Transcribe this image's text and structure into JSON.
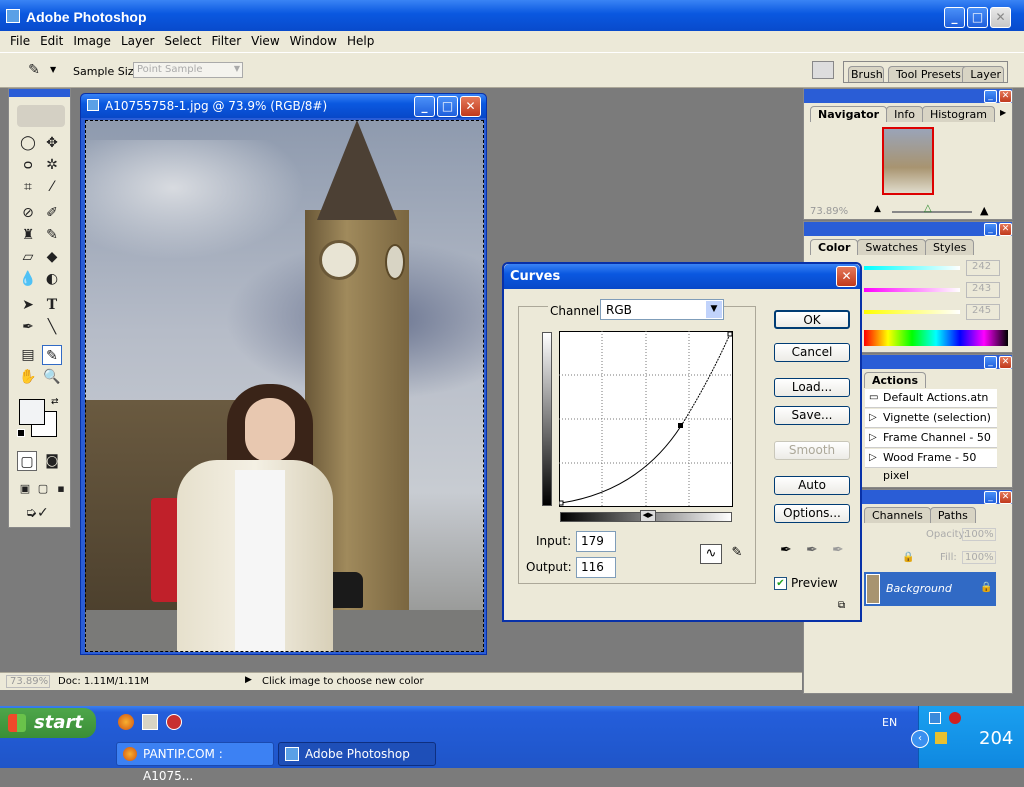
{
  "app": {
    "title": "Adobe Photoshop"
  },
  "menu": [
    "File",
    "Edit",
    "Image",
    "Layer",
    "Select",
    "Filter",
    "View",
    "Window",
    "Help"
  ],
  "options": {
    "sample_size_label": "Sample Size:",
    "sample_size_value": "Point Sample"
  },
  "well_tabs": [
    "Brushes",
    "Tool Presets",
    "Layer Comps"
  ],
  "document": {
    "title": "A10755758-1.jpg @ 73.9% (RGB/8#)"
  },
  "navigator": {
    "tabs": [
      "Navigator",
      "Info",
      "Histogram"
    ],
    "zoom": "73.89%"
  },
  "color_panel": {
    "tabs": [
      "Color",
      "Swatches",
      "Styles"
    ],
    "r": "242",
    "g": "243",
    "b": "245"
  },
  "actions": {
    "tab": "Actions",
    "items": [
      "Default Actions.atn",
      "Vignette (selection)",
      "Frame Channel - 50 pixel",
      "Wood Frame - 50 pixel"
    ]
  },
  "layers": {
    "tabs": [
      "Channels",
      "Paths"
    ],
    "opacity_label": "Opacity:",
    "opacity": "100%",
    "fill_label": "Fill:",
    "fill": "100%",
    "layer_name": "Background"
  },
  "curves": {
    "title": "Curves",
    "channel_label": "Channel:",
    "channel": "RGB",
    "buttons": {
      "ok": "OK",
      "cancel": "Cancel",
      "load": "Load...",
      "save": "Save...",
      "smooth": "Smooth",
      "auto": "Auto",
      "options": "Options..."
    },
    "input_label": "Input:",
    "input": "179",
    "output_label": "Output:",
    "output": "116",
    "preview_label": "Preview"
  },
  "status": {
    "zoom": "73.89%",
    "doc": "Doc: 1.11M/1.11M",
    "hint": "Click image to choose new color"
  },
  "taskbar": {
    "start": "start",
    "tasks": [
      "PANTIP.COM : A1075...",
      "Adobe Photoshop"
    ],
    "lang": "EN",
    "clock": "204"
  }
}
